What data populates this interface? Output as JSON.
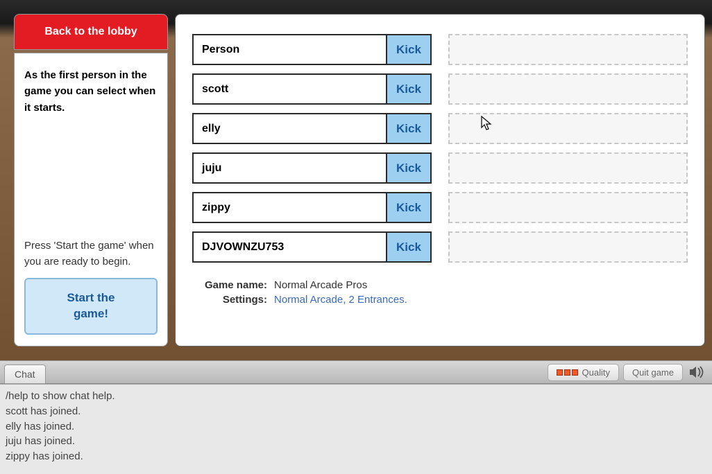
{
  "back_button": "Back to the lobby",
  "info_top": "As the first person in the game you can select when it starts.",
  "info_bottom": "Press 'Start the game' when you are ready to begin.",
  "start_button": "Start the\ngame!",
  "players": [
    {
      "name": "Person",
      "action": "Kick"
    },
    {
      "name": "scott",
      "action": "Kick"
    },
    {
      "name": "elly",
      "action": "Kick"
    },
    {
      "name": "juju",
      "action": "Kick"
    },
    {
      "name": "zippy",
      "action": "Kick"
    },
    {
      "name": "DJVOWNZU753",
      "action": "Kick"
    }
  ],
  "empty_slots": 6,
  "game_info": {
    "name_label": "Game name:",
    "name_value": "Normal Arcade Pros",
    "settings_label": "Settings:",
    "settings_value": "Normal Arcade, 2 Entrances."
  },
  "bottom_bar": {
    "chat_tab": "Chat",
    "quality_button": "Quality",
    "quit_button": "Quit game"
  },
  "chat_log": [
    "/help   to show chat help.",
    "scott  has joined.",
    "elly has joined.",
    "juju has joined.",
    "zippy has joined."
  ]
}
